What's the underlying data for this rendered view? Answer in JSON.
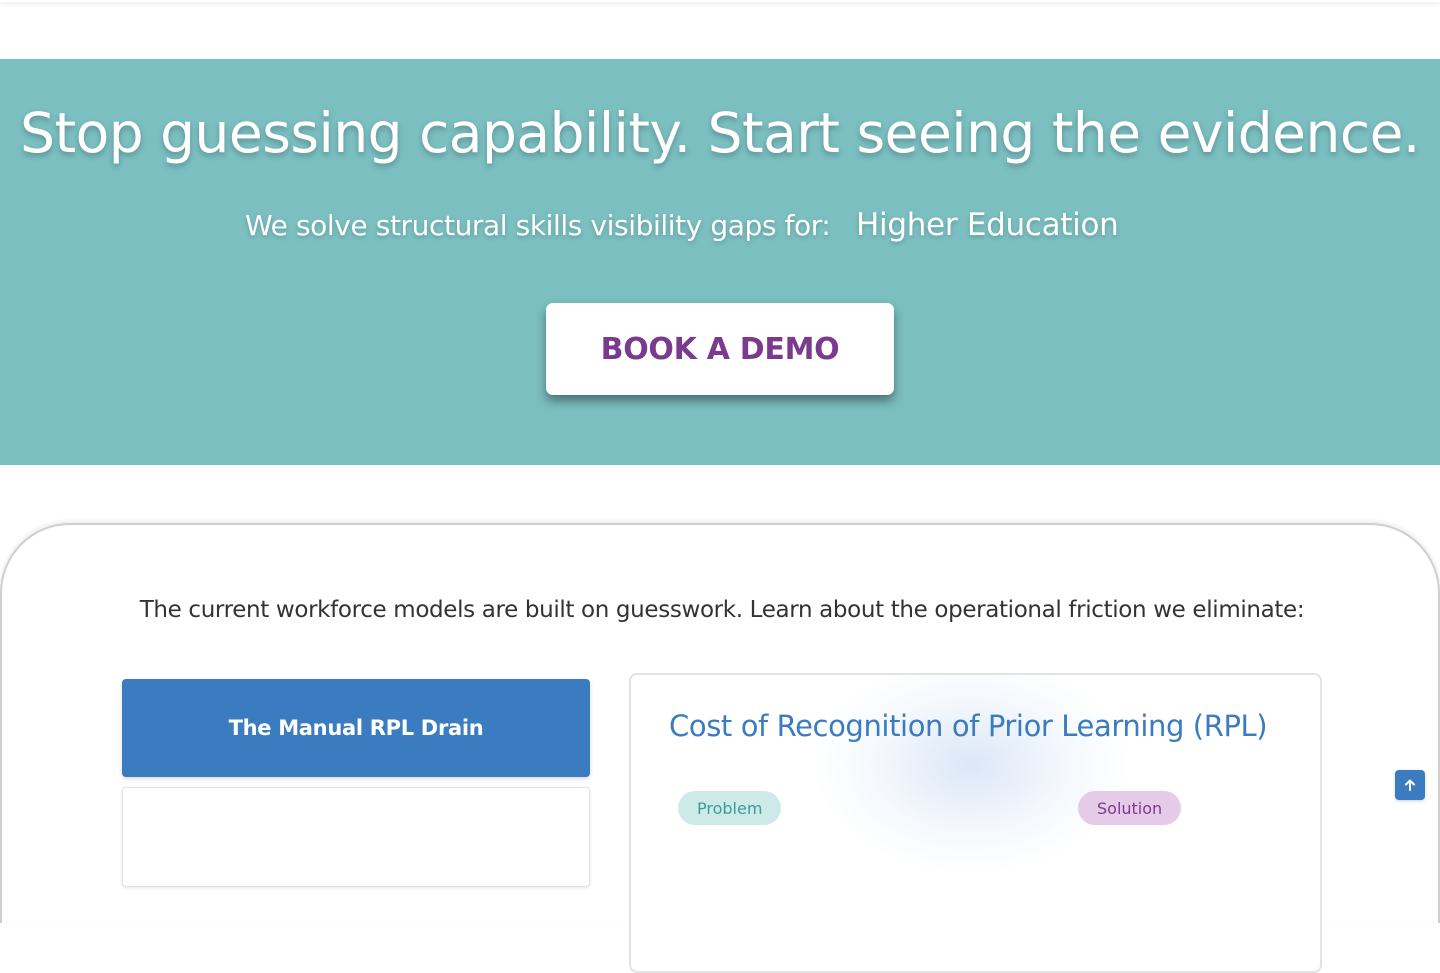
{
  "hero": {
    "title": "Stop guessing capability. Start seeing the evidence.",
    "subtitle": "We solve structural skills visibility gaps for:",
    "sector": "Higher Education",
    "cta_label": "BOOK A DEMO",
    "background_color": "#7bbfc1",
    "cta_text_color": "#7a3b8f"
  },
  "friction": {
    "intro": "The current workforce models are built on guesswork. Learn about the operational friction we eliminate:",
    "tabs": [
      {
        "label": "The Manual RPL Drain",
        "active": true
      },
      {
        "label": "",
        "active": false
      }
    ],
    "card": {
      "title": "Cost of Recognition of Prior Learning (RPL)",
      "problem_badge": "Problem",
      "solution_badge": "Solution"
    },
    "accent_color": "#3b7bbf"
  },
  "scroll_top": {
    "icon": "arrow-up-icon"
  }
}
